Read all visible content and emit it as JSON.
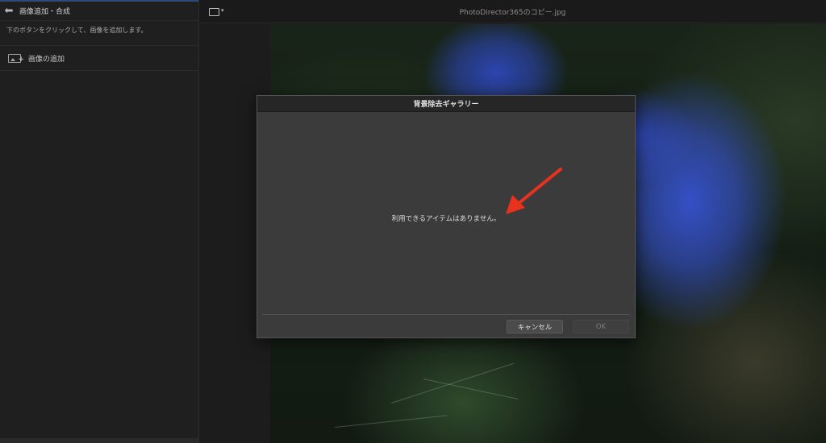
{
  "left_panel": {
    "title": "画像追加・合成",
    "instruction": "下のボタンをクリックして、画像を追加します。",
    "add_image_label": "画像の追加",
    "back_icon": "back-arrow-icon",
    "add_image_icon": "add-image-icon"
  },
  "top_bar": {
    "file_name": "PhotoDirector365のコピー.jpg",
    "folder_icon": "folder-icon"
  },
  "dialog": {
    "title": "背景除去ギャラリー",
    "empty_message": "利用できるアイテムはありません。",
    "cancel_label": "キャンセル",
    "ok_label": "OK",
    "annotation_color": "#e8321e"
  },
  "colors": {
    "accent_bar": "#2e4a78",
    "dialog_bg": "#3b3b3c",
    "annotation_arrow": "#e8321e"
  }
}
